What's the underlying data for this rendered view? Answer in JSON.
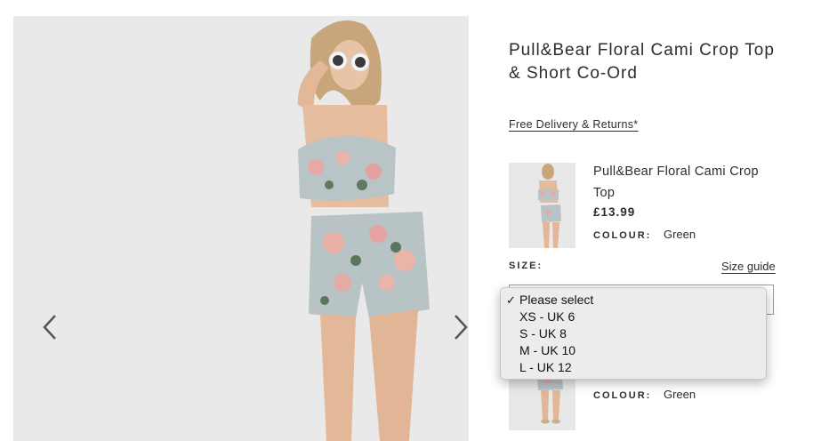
{
  "product": {
    "title": "Pull&Bear Floral Cami Crop Top & Short Co-Ord",
    "delivery_link": "Free Delivery & Returns*"
  },
  "items": [
    {
      "name": "Pull&Bear Floral Cami Crop Top",
      "price": "£13.99",
      "colour_label": "COLOUR:",
      "colour_value": "Green"
    },
    {
      "colour_label": "COLOUR:",
      "colour_value": "Green"
    }
  ],
  "size": {
    "label": "SIZE:",
    "guide_link": "Size guide",
    "selected": "Please select",
    "options": [
      "Please select",
      "XS - UK 6",
      "S - UK 8",
      "M - UK 10",
      "L - UK 12"
    ]
  },
  "icons": {
    "prev": "chevron-left-icon",
    "next": "chevron-right-icon",
    "selected_mark": "checkmark-icon"
  },
  "colors": {
    "text": "#2d2d2d",
    "image_background": "#eaeaea",
    "dropdown_background": "#ececec"
  }
}
